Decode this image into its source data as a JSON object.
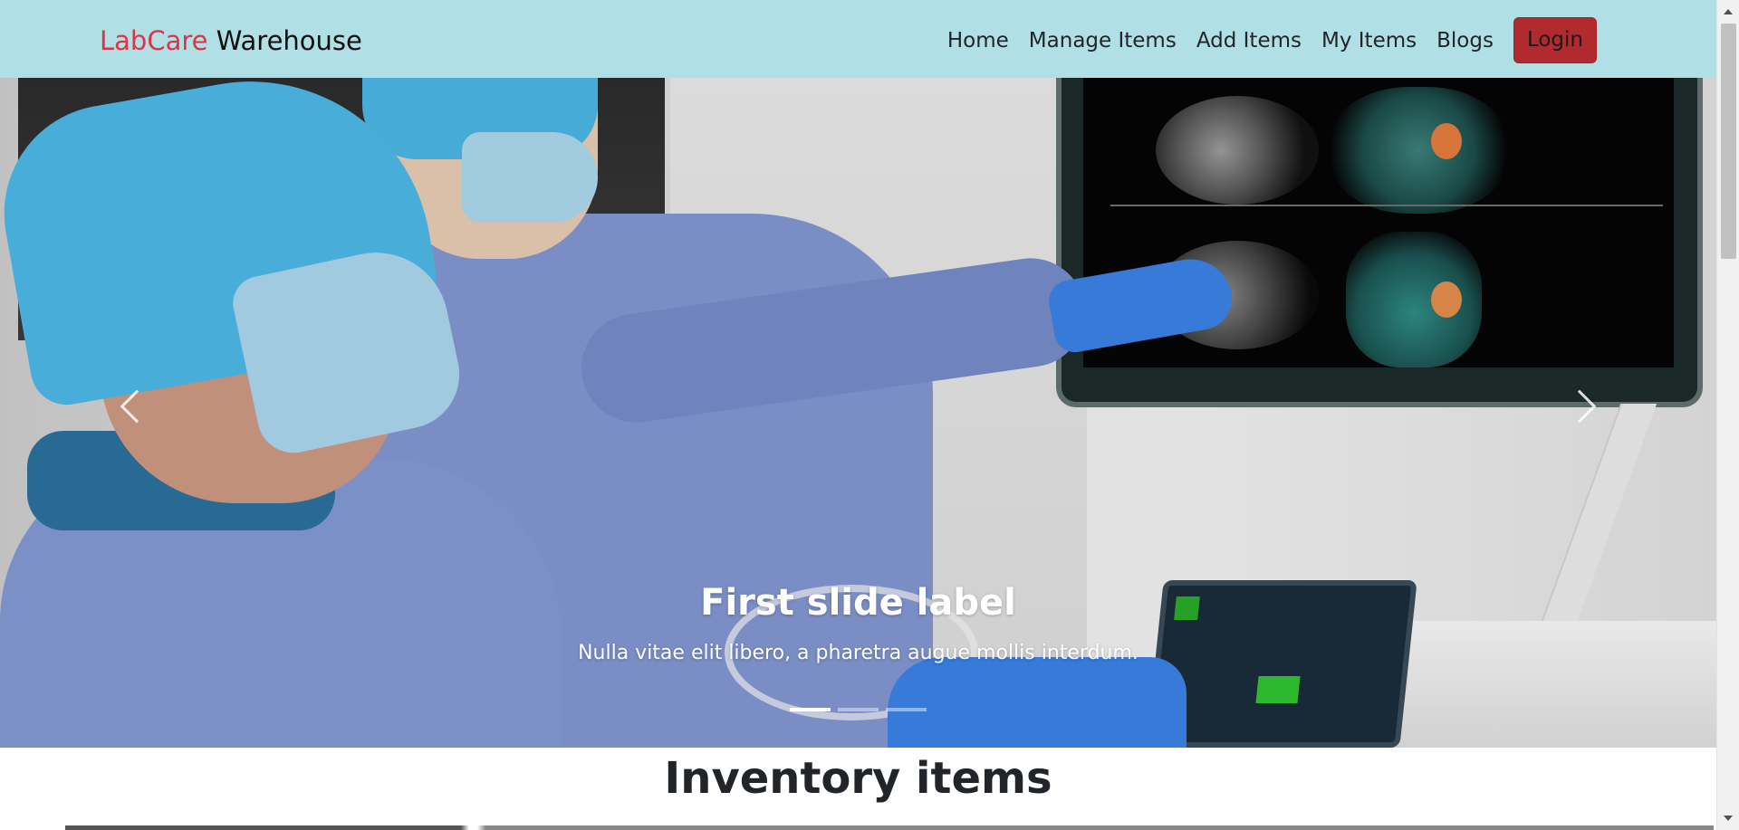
{
  "navbar": {
    "brand_part1": "LabCare",
    "brand_part2": " Warehouse",
    "links": [
      "Home",
      "Manage Items",
      "Add Items",
      "My Items",
      "Blogs"
    ],
    "login_label": "Login",
    "colors": {
      "background": "#b0dfe5",
      "brand_accent": "#dc3545",
      "login_bg": "#b02a2f"
    }
  },
  "carousel": {
    "slide_title": "First slide label",
    "slide_text": "Nulla vitae elit libero, a pharetra augue mollis interdum.",
    "active_index": 0,
    "slide_count": 3,
    "prev_icon": "chevron-left-icon",
    "next_icon": "chevron-right-icon"
  },
  "section": {
    "title": "Inventory items"
  }
}
